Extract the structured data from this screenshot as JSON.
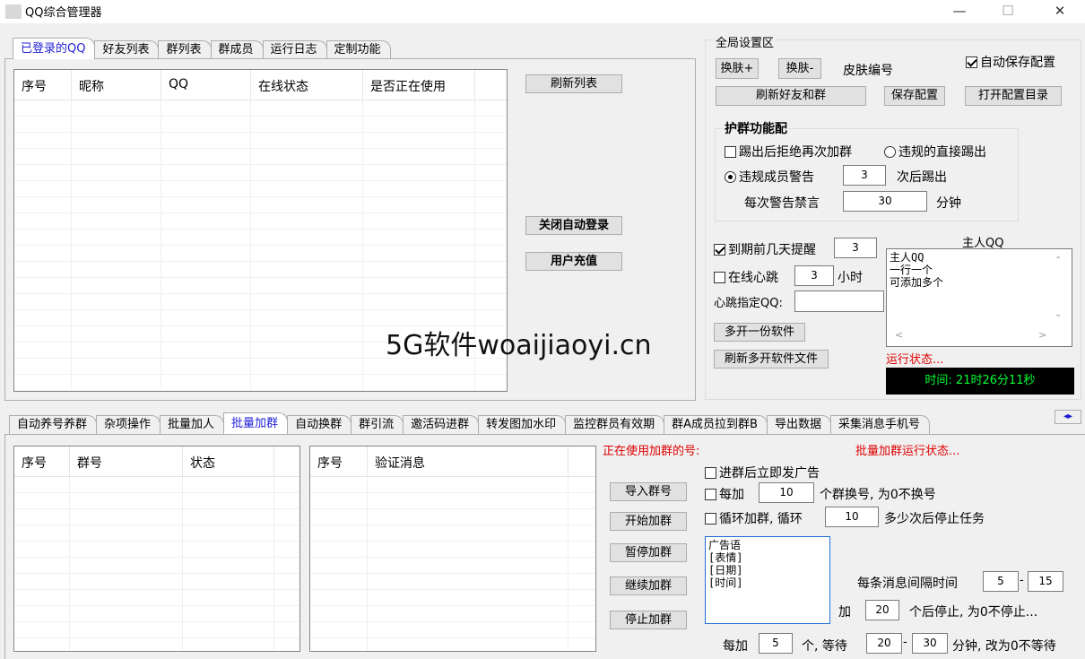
{
  "window": {
    "title": "QQ综合管理器",
    "min": "—",
    "max": "☐",
    "close": "✕"
  },
  "top_tabs": [
    "已登录的QQ",
    "好友列表",
    "群列表",
    "群成员",
    "运行日志",
    "定制功能"
  ],
  "accounts_table": {
    "columns": [
      "序号",
      "昵称",
      "QQ",
      "在线状态",
      "是否正在使用"
    ]
  },
  "left_buttons": {
    "refresh_list": "刷新列表",
    "disable_autologin": "关闭自动登录",
    "recharge": "用户充值"
  },
  "global": {
    "title": "全局设置区",
    "skin_next": "换肤+",
    "skin_prev": "换肤-",
    "skin_no": "皮肤编号",
    "auto_save": "自动保存配置",
    "refresh_friends": "刷新好友和群",
    "save_config": "保存配置",
    "open_config_dir": "打开配置目录"
  },
  "protect": {
    "title": "护群功能配",
    "reject_rejoin": "踢出后拒绝再次加群",
    "kick_direct": "违规的直接踢出",
    "warn": "违规成员警告",
    "warn_count": "3",
    "kick_after": "次后踢出",
    "mute_label": "每次警告禁言",
    "mute_minutes": "30",
    "minutes": "分钟"
  },
  "expire": {
    "label": "到期前几天提醒",
    "days": "3",
    "heartbeat": "在线心跳",
    "heartbeat_hours": "3",
    "hours": "小时",
    "heartbeat_qq": "心跳指定QQ:",
    "heartbeat_qq_value": ""
  },
  "owner": {
    "title": "主人QQ",
    "memo": "主人QQ\n一行一个\n可添加多个",
    "multi_open": "多开一份软件",
    "refresh_multi": "刷新多开软件文件",
    "run_status": "运行状态...",
    "time": "时间: 21时26分11秒"
  },
  "watermark": "5G软件woaijiaoyi.cn",
  "bottom_tabs": [
    "自动养号养群",
    "杂项操作",
    "批量加人",
    "批量加群",
    "自动换群",
    "群引流",
    "邀活码进群",
    "转发图加水印",
    "监控群员有效期",
    "群A成员拉到群B",
    "导出数据",
    "采集消息手机号"
  ],
  "groups_table": {
    "columns": [
      "序号",
      "群号",
      "状态"
    ]
  },
  "verify_table": {
    "columns": [
      "序号",
      "验证消息"
    ]
  },
  "join": {
    "using_label": "正在使用加群的号:",
    "status": "批量加群运行状态...",
    "import": "导入群号",
    "start": "开始加群",
    "pause": "暂停加群",
    "resume": "继续加群",
    "stop": "停止加群",
    "ad_after_join": "进群后立即发广告",
    "every_add": "每加",
    "every_add_n": "10",
    "switch_note": "个群换号, 为0不换号",
    "loop": "循环加群, 循环",
    "loop_n": "10",
    "loop_note": "多少次后停止任务",
    "ad_memo": "广告语\n[表情]\n[日期]\n[时间]",
    "interval_label": "每条消息间隔时间",
    "interval_min": "5",
    "interval_max": "15",
    "add_label": "加",
    "add_n": "20",
    "stop_note": "个后停止, 为0不停止...",
    "wait_prefix": "每加",
    "wait_n": "5",
    "wait_mid": "个, 等待",
    "wait_min": "20",
    "wait_max": "30",
    "wait_note": "分钟, 改为0不等待",
    "dash": "-"
  }
}
